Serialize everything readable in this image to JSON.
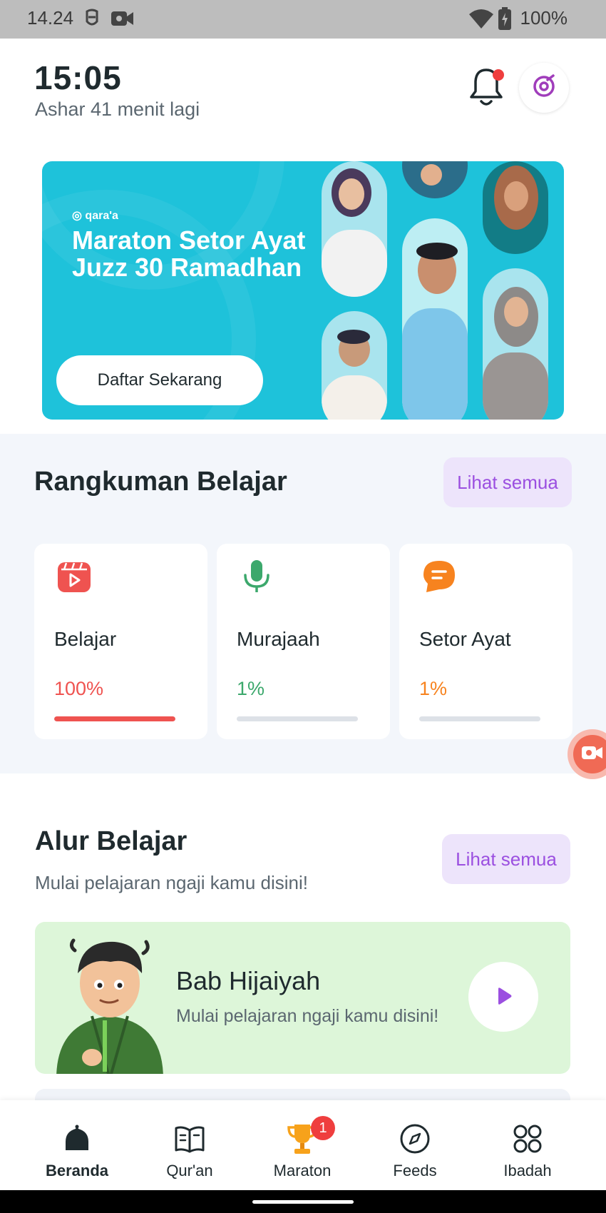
{
  "status_bar": {
    "time": "14.24",
    "battery": "100%",
    "icons": [
      "face-icon",
      "video-camera-icon",
      "wifi-icon",
      "battery-charging-icon"
    ]
  },
  "header": {
    "clock": "15:05",
    "next_prayer": "Ashar 41 menit lagi",
    "icons": [
      "bell-icon",
      "qaraa-logo-icon"
    ]
  },
  "banner": {
    "brand": "qara'a",
    "title": "Maraton Setor Ayat Juzz 30 Ramadhan",
    "cta_label": "Daftar Sekarang",
    "background_color": "#1ec2da"
  },
  "summary": {
    "title": "Rangkuman Belajar",
    "see_all_label": "Lihat semua",
    "cards": [
      {
        "label": "Belajar",
        "percent": "100%",
        "progress": 1.0,
        "color": "#ef5350",
        "icon": "video-play-icon"
      },
      {
        "label": "Murajaah",
        "percent": "1%",
        "progress": 0.0,
        "color": "#3ca86c",
        "icon": "microphone-icon"
      },
      {
        "label": "Setor Ayat",
        "percent": "1%",
        "progress": 0.0,
        "color": "#f7831f",
        "icon": "chat-bubble-icon"
      }
    ]
  },
  "learning_path": {
    "title": "Alur Belajar",
    "subtitle": "Mulai pelajaran ngaji kamu disini!",
    "see_all_label": "Lihat semua",
    "lesson": {
      "title": "Bab Hijaiyah",
      "subtitle": "Mulai pelajaran ngaji kamu disini!"
    }
  },
  "bottom_nav": {
    "items": [
      {
        "label": "Beranda",
        "icon": "home-icon",
        "active": true
      },
      {
        "label": "Qur'an",
        "icon": "book-icon",
        "active": false
      },
      {
        "label": "Maraton",
        "icon": "trophy-icon",
        "active": false
      },
      {
        "label": "Feeds",
        "icon": "compass-icon",
        "active": false
      },
      {
        "label": "Ibadah",
        "icon": "grid-icon",
        "active": false
      }
    ],
    "maraton_badge": "1"
  },
  "colors": {
    "accent_purple": "#9b4fe0",
    "section_bg": "#f3f6fb",
    "lesson_bg": "#ddf6d9"
  }
}
